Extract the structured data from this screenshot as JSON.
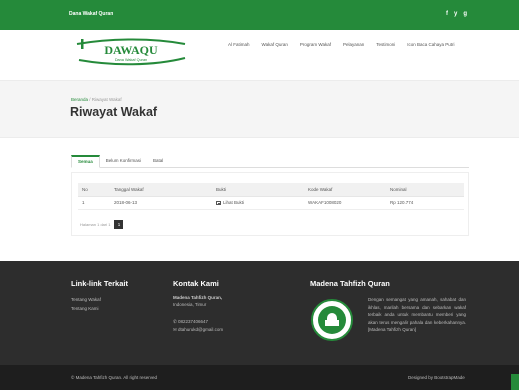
{
  "topbar": {
    "brand": "Dana Wakaf Quran",
    "social": [
      "f",
      "y",
      "g"
    ]
  },
  "logo": {
    "text": "DAWAQU",
    "tagline": "Dana Wakaf Quran"
  },
  "nav": {
    "items": [
      "Al Fatimah",
      "Wakaf Quran",
      "Program Wakaf",
      "Pelayanan",
      "Testimoni",
      "Icon Baca Cahaya Putri"
    ]
  },
  "breadcrumb": {
    "home": "Beranda",
    "separator": " / ",
    "current": "Riwayat Wakaf"
  },
  "page_title": "Riwayat Wakaf",
  "tabs": [
    {
      "label": "Semua",
      "active": true
    },
    {
      "label": "Belum Konfirmasi",
      "active": false
    },
    {
      "label": "Batal",
      "active": false
    }
  ],
  "table": {
    "headers": [
      "No",
      "Tanggal Wakaf",
      "Bukti",
      "Kode Wakaf",
      "Nominal"
    ],
    "rows": [
      [
        "1",
        "2018-06-13",
        "Lihat Bukti",
        "WAKAF1008020",
        "Rp 120.774"
      ]
    ]
  },
  "pager": {
    "info": "Halaman 1 dari 1",
    "current_page": "1"
  },
  "footer": {
    "links_title": "Link-link Terkait",
    "links": [
      "Tentang Wakaf",
      "Tentang Kami"
    ],
    "contact_title": "Kontak Kami",
    "contact_name": "Madena Tahfizh Quran,",
    "contact_city": "Indonesia, Timur",
    "contact_phone": "082237406647",
    "contact_email": "dtahurukd@gmail.com",
    "about_title": "Madena Tahfizh Quran",
    "about_text": "Dengan semangat yang amanah, sahabat dan ikhlas, marilah bersama dan sebarkan wakaf terbaik anda untuk membantu memberi yang akan terus mengalir pahala dan keberkahannya. [Madena Tahfizh Quran]"
  },
  "bottom": {
    "copyright": "© Madena Tahfizh Quran. All right reserved",
    "designed": "Designed by BootstrapMade"
  },
  "colors": {
    "brand_green": "#258a3a",
    "footer_dark": "#2d2d2d"
  }
}
